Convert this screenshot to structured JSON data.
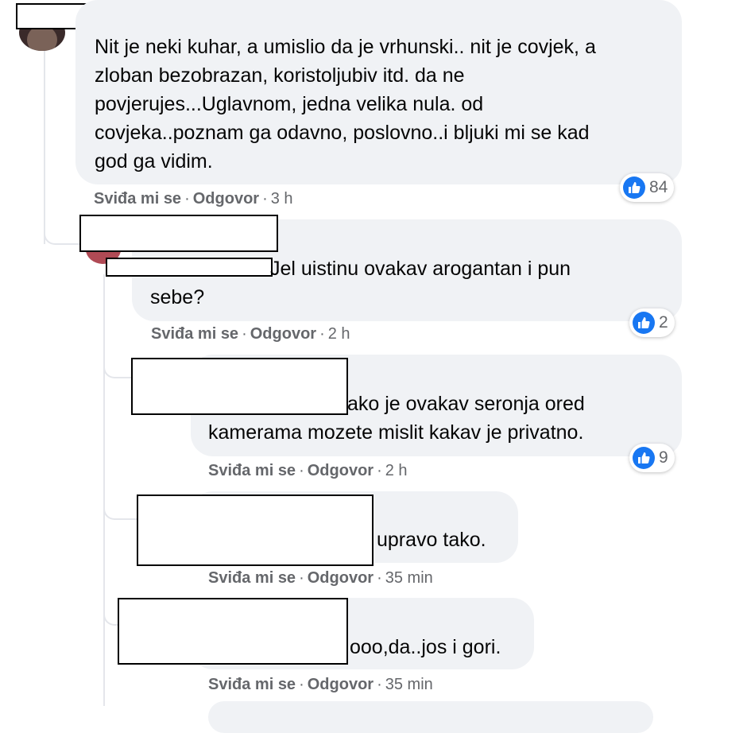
{
  "actions": {
    "like_label": "Sviđa mi se",
    "reply_label": "Odgovor",
    "separator": "·"
  },
  "comments": [
    {
      "lines": [
        "Nit je neki kuhar, a umislio da je vrhunski.. nit je covjek, a",
        "zloban bezobrazan, koristoljubiv itd. da ne",
        "povjerujes...Uglavnom, jedna velika nula. od",
        "covjeka..poznam ga odavno, poslovno..i bljuki mi se kad",
        "god ga vidim."
      ],
      "time": "3 h",
      "reaction_icon": "like-icon",
      "reaction_count": "84"
    },
    {
      "lines": [
        "Jel uistinu ovakav arogantan i pun",
        "sebe?"
      ],
      "time": "2 h",
      "reaction_icon": "like-icon",
      "reaction_count": "2"
    },
    {
      "lines": [
        "ako je ovakav seronja ored",
        "kamerama mozete mislit kakav je privatno."
      ],
      "time": "2 h",
      "reaction_icon": "like-icon",
      "reaction_count": "9"
    },
    {
      "lines": [
        "upravo tako."
      ],
      "time": "35 min"
    },
    {
      "lines": [
        "ooo,da..jos i gori."
      ],
      "time": "35 min"
    }
  ],
  "colors": {
    "bubble": "#f0f2f5",
    "meta_text": "#65676b",
    "like_blue": "#1877f2"
  }
}
